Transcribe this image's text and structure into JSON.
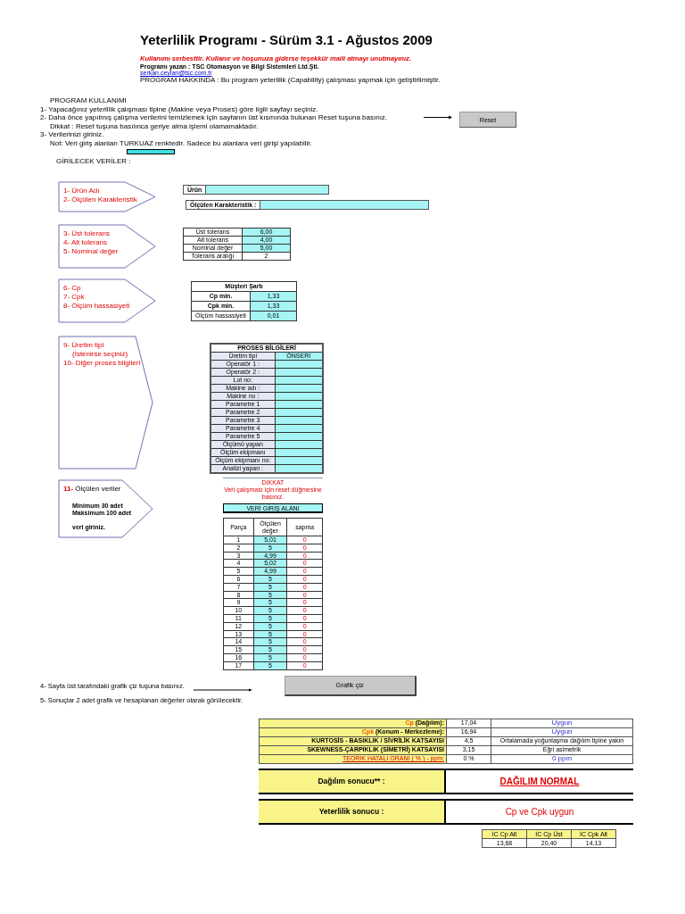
{
  "header": {
    "title": "Yeterlilik Programı - Sürüm 3.1 - Ağustos 2009",
    "notice": "Kullanımı serbesttir. Kullanır ve hoşunuza giderse teşekkür maili atmayı unutmayınız.",
    "author": "Programı yazan : TSC Otomasyon ve Bilgi Sistemleri Ltd.Şti.",
    "email": "serkan.ceylan@tsc.com.tr",
    "about": "PROGRAM HAKKINDA : Bu program yeterlilik (Capability) çalışması yapmak için geliştirilmiştir."
  },
  "usage": {
    "heading": "PROGRAM KULLANIMI",
    "lines": [
      {
        "kind": "step",
        "text": "1- Yapacağınız yeterlilik çalışması tipine (Makine veya Proses) göre ilgili sayfayı seçiniz."
      },
      {
        "kind": "step",
        "text": "2- Daha önce yapılmış çalışma verilerini temizlemek için sayfanın üst kısmında bulunan Reset tuşuna basınız."
      },
      {
        "kind": "note",
        "text": "Dikkat : Reset tuşuna basılınca geriye alma işlemi olamamaktadır."
      },
      {
        "kind": "step",
        "text": "3- Verilerinizi giriniz."
      },
      {
        "kind": "note",
        "text": "Not: Veri giriş alanları TURKUAZ renktedir. Sadece bu alanlara veri girişi yapılabilir."
      }
    ],
    "reset_button": "Reset",
    "inputs_heading": "GİRİLECEK VERİLER :"
  },
  "sections": [
    {
      "kind": "product",
      "labels": [
        "1-   Ürün Adı",
        "2- Ölçülen Karakteristik"
      ],
      "fields": [
        {
          "label": "Ürün"
        },
        {
          "label": "Ölçülen Karakteristik :"
        }
      ]
    },
    {
      "kind": "tolerance",
      "labels": [
        "3- Üst tolerans",
        "4- Alt tolerans",
        "5- Nominal değer"
      ],
      "rows": [
        {
          "label": "Üst tolerans",
          "value": "6,00",
          "input": true
        },
        {
          "label": "Alt tolerans",
          "value": "4,00",
          "input": true
        },
        {
          "label": "Nominal değer",
          "value": "5,00",
          "input": true
        },
        {
          "label": "Tolerans aralığı",
          "value": "2",
          "input": false
        }
      ]
    },
    {
      "kind": "customer",
      "labels": [
        "6- Cp",
        "7- Cpk",
        "8- Ölçüm hassasiyeti"
      ],
      "title": "Müşteri Şartı",
      "rows": [
        {
          "label": "Cp min.",
          "value": "1,33"
        },
        {
          "label": "Cpk min.",
          "value": "1,33"
        },
        {
          "label": "Ölçüm hassasiyeti",
          "value": "0,01"
        }
      ]
    },
    {
      "kind": "process",
      "labels": [
        "9- Üretim tipi",
        "(İstenirse seçiniz)",
        "10- Diğer proses bilgileri"
      ],
      "title": "PROSES BİLGİLERİ",
      "rows": [
        {
          "label": "Üretim tipi",
          "value": "ÖNSERİ"
        },
        {
          "label": "Operatör 1 :"
        },
        {
          "label": "Operatör 2 :"
        },
        {
          "label": "Lot no:"
        },
        {
          "label": "Makine adı :"
        },
        {
          "label": "Makine no :"
        },
        {
          "label": "Parametre 1"
        },
        {
          "label": "Parametre 2"
        },
        {
          "label": "Parametre 3"
        },
        {
          "label": "Parametre 4"
        },
        {
          "label": "Parametre 5"
        },
        {
          "label": "Ölçümü yapan"
        },
        {
          "label": "Ölçüm ekipmanı"
        },
        {
          "label": "Ölçüm ekipmanı no:"
        },
        {
          "label": "Analizi yapan :"
        }
      ]
    },
    {
      "kind": "data",
      "number": "11-",
      "heading": "Ölçülen veriler",
      "notes": [
        "Minimum 30 adet",
        "Maksimum 100 adet",
        "veri giriniz."
      ],
      "warning_title": "DİKKAT",
      "warning": "Veri çalışması için reset düğmesine basınız.",
      "title": "VERİ GİRİŞ ALANI",
      "columns": [
        "Parça",
        "Ölçülen değer",
        "sapma"
      ],
      "rows": [
        {
          "part": "1",
          "value": "5,01",
          "deviation": "0"
        },
        {
          "part": "2",
          "value": "5",
          "deviation": "0"
        },
        {
          "part": "3",
          "value": "4,99",
          "deviation": "0"
        },
        {
          "part": "4",
          "value": "5,02",
          "deviation": "0"
        },
        {
          "part": "5",
          "value": "4,99",
          "deviation": "0"
        },
        {
          "part": "6",
          "value": "5",
          "deviation": "0"
        },
        {
          "part": "7",
          "value": "5",
          "deviation": "0"
        },
        {
          "part": "8",
          "value": "5",
          "deviation": "0"
        },
        {
          "part": "9",
          "value": "5",
          "deviation": "0"
        },
        {
          "part": "10",
          "value": "5",
          "deviation": "0"
        },
        {
          "part": "11",
          "value": "5",
          "deviation": "0"
        },
        {
          "part": "12",
          "value": "5",
          "deviation": "0"
        },
        {
          "part": "13",
          "value": "5",
          "deviation": "0"
        },
        {
          "part": "14",
          "value": "5",
          "deviation": "0"
        },
        {
          "part": "15",
          "value": "5",
          "deviation": "0"
        },
        {
          "part": "16",
          "value": "5",
          "deviation": "0"
        },
        {
          "part": "17",
          "value": "5",
          "deviation": "0"
        }
      ]
    }
  ],
  "finish": {
    "step4": "4- Sayfa üst tarafındaki grafik çiz tuşuna basınız.",
    "chart_button": "Grafik çiz",
    "step5": "5- Sonuçlar 2 adet grafik ve hesaplanan değerler olarak görülecektir."
  },
  "results": {
    "rows": [
      {
        "kind": "index",
        "symbol": "Cp",
        "label": "(Dağılım):",
        "value": "17,04",
        "result": "Uygun"
      },
      {
        "kind": "index",
        "symbol": "Cpk",
        "label": "(Konum - Merkezleme):",
        "value": "16,94",
        "result": "Uygun"
      },
      {
        "kind": "coef",
        "label": "KURTOSİS - BASIKLIK / SİVRİLİK KATSAYISI",
        "value": "4,5",
        "result": "Ortalamada yoğunlaşma dağılım tipine yakın"
      },
      {
        "kind": "coef",
        "label": "SKEWNESS-ÇARPIKLIK (SİMETRİ) KATSAYISI",
        "value": "3,15",
        "result": "Eğri asimetrik"
      },
      {
        "kind": "error",
        "label": "TEORİK HATALI ORANI ( % ) - ppm:",
        "value": "0 %",
        "result": "0 ppm"
      }
    ],
    "outcomes": [
      {
        "kind": "distribution",
        "label": "Dağılım sonucu** :",
        "value": "DAĞILIM NORMAL"
      },
      {
        "kind": "capability",
        "label": "Yeterlilik sonucu :",
        "value": "Cp ve Cpk uygun"
      }
    ],
    "ci_columns": [
      "İC Cp Alt",
      "İC Cp Üst",
      "İC Cpk Alt"
    ],
    "ci_values": [
      "13,68",
      "20,40",
      "14,13"
    ]
  }
}
